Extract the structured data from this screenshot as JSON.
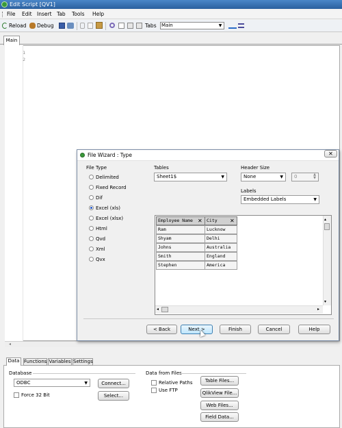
{
  "window": {
    "title": "Edit Script [QV1]"
  },
  "menu": [
    "File",
    "Edit",
    "Insert",
    "Tab",
    "Tools",
    "Help"
  ],
  "toolbar": {
    "reload": "Reload",
    "debug": "Debug",
    "tabs_label": "Tabs",
    "tabs_value": "Main"
  },
  "editor": {
    "tab": "Main",
    "line_numbers": [
      "1",
      "2"
    ]
  },
  "wizard": {
    "title": "File Wizard : Type",
    "file_type_label": "File Type",
    "file_types": [
      "Delimited",
      "Fixed Record",
      "Dif",
      "Excel (xls)",
      "Excel (xlsx)",
      "Html",
      "Qvd",
      "Xml",
      "Qvx"
    ],
    "selected_file_type": "Excel (xls)",
    "tables_label": "Tables",
    "tables_value": "Sheet1$",
    "header_size_label": "Header Size",
    "header_size_value": "None",
    "header_size_number": "0",
    "labels_label": "Labels",
    "labels_value": "Embedded Labels",
    "columns": [
      "Employee Name",
      "City"
    ],
    "rows": [
      [
        "Ram",
        "Lucknow"
      ],
      [
        "Shyam",
        "Delhi"
      ],
      [
        "Johns",
        "Australia"
      ],
      [
        "Smith",
        "England"
      ],
      [
        "Stephen",
        "America"
      ]
    ],
    "buttons": {
      "back": "< Back",
      "next": "Next >",
      "finish": "Finish",
      "cancel": "Cancel",
      "help": "Help"
    }
  },
  "bottom": {
    "tabs": [
      "Data",
      "Functions",
      "Variables",
      "Settings"
    ],
    "database_label": "Database",
    "database_value": "ODBC",
    "connect": "Connect...",
    "select": "Select...",
    "force32": "Force 32 Bit",
    "data_from_files_label": "Data from Files",
    "relative_paths": "Relative Paths",
    "use_ftp": "Use FTP",
    "table_files": "Table Files...",
    "qlikview_file": "QlikView File...",
    "web_files": "Web Files...",
    "field_data": "Field Data..."
  }
}
